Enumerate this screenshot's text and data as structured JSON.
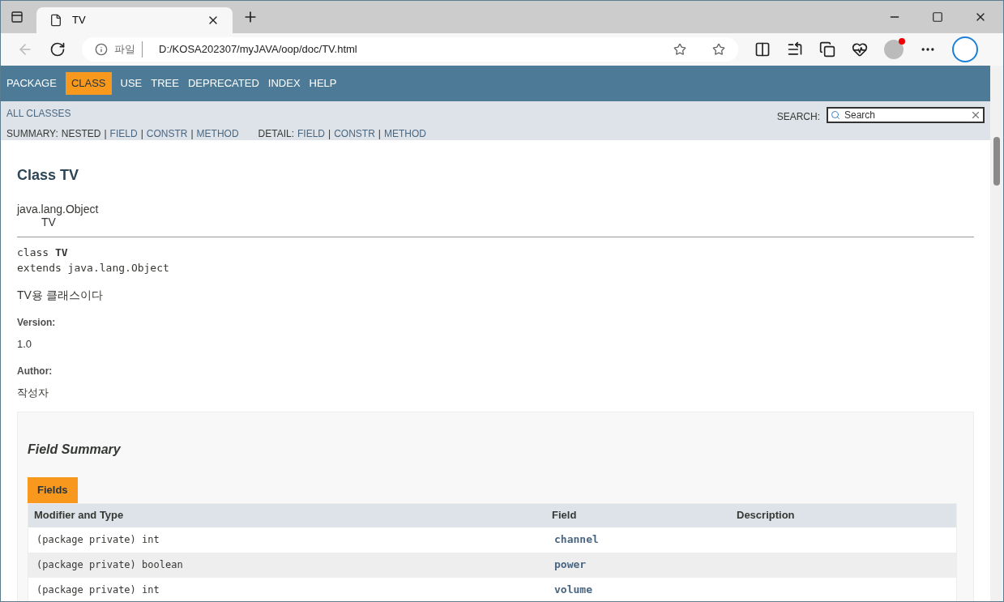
{
  "browser": {
    "tab": {
      "title": "TV"
    },
    "address": {
      "scheme": "파일",
      "url": "D:/KOSA202307/myJAVA/oop/doc/TV.html"
    }
  },
  "nav": {
    "items": [
      {
        "label": "PACKAGE",
        "selected": false
      },
      {
        "label": "CLASS",
        "selected": true
      },
      {
        "label": "USE",
        "selected": false
      },
      {
        "label": "TREE",
        "selected": false
      },
      {
        "label": "DEPRECATED",
        "selected": false
      },
      {
        "label": "INDEX",
        "selected": false
      },
      {
        "label": "HELP",
        "selected": false
      }
    ]
  },
  "subnav": {
    "all_classes": "ALL CLASSES",
    "search_label": "SEARCH:",
    "search": {
      "placeholder": "Search"
    },
    "separator": "|",
    "summary": {
      "label": "SUMMARY:",
      "items": [
        {
          "text": "NESTED",
          "link": false
        },
        {
          "text": "FIELD",
          "link": true
        },
        {
          "text": "CONSTR",
          "link": true
        },
        {
          "text": "METHOD",
          "link": true
        }
      ]
    },
    "detail": {
      "label": "DETAIL:",
      "items": [
        {
          "text": "FIELD",
          "link": true
        },
        {
          "text": "CONSTR",
          "link": true
        },
        {
          "text": "METHOD",
          "link": true
        }
      ]
    }
  },
  "content": {
    "title": "Class TV",
    "inheritance": [
      "java.lang.Object",
      "TV"
    ],
    "signature": [
      "class **TV**",
      "extends java.lang.Object"
    ],
    "description": "TV용 클래스이다",
    "tags": [
      {
        "label": "Version:",
        "value": "1.0"
      },
      {
        "label": "Author:",
        "value": "작성자"
      }
    ],
    "field_summary": {
      "heading": "Field Summary",
      "caption": "Fields",
      "columns": [
        "Modifier and Type",
        "Field",
        "Description"
      ],
      "rows": [
        {
          "type": "(package private) int",
          "field": "channel"
        },
        {
          "type": "(package private) boolean",
          "field": "power"
        },
        {
          "type": "(package private) int",
          "field": "volume"
        }
      ]
    }
  }
}
